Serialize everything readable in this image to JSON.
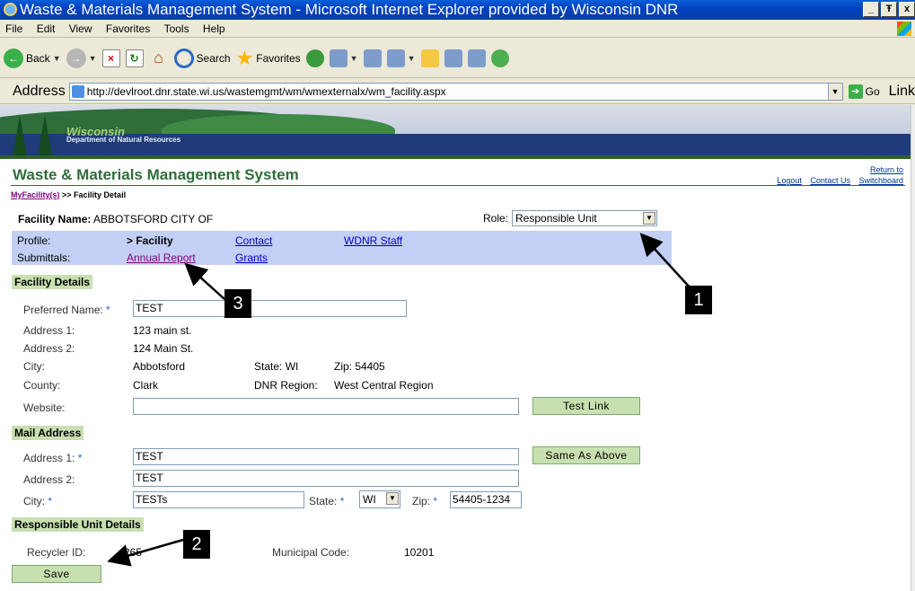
{
  "window": {
    "title": "Waste & Materials Management System - Microsoft Internet Explorer provided by Wisconsin DNR",
    "controls": [
      "_",
      "Ŧ",
      "x"
    ]
  },
  "menu": [
    "File",
    "Edit",
    "View",
    "Favorites",
    "Tools",
    "Help"
  ],
  "toolbar": {
    "back": "Back",
    "search": "Search",
    "favorites": "Favorites"
  },
  "address": {
    "label": "Address",
    "url": "http://devlroot.dnr.state.wi.us/wastemgmt/wm/wmexternalx/wm_facility.aspx",
    "go": "Go",
    "links": "Link"
  },
  "banner": {
    "org_title": "Wisconsin",
    "org_sub": "Department of Natural Resources"
  },
  "header": {
    "app_title": "Waste & Materials Management System",
    "logout": "Logout",
    "contact": "Contact Us",
    "return_top": "Return to",
    "return_bottom": "Switchboard"
  },
  "breadcrumb": {
    "link": "MyFacility(s)",
    "rest": ">> Facility Detail"
  },
  "facility": {
    "name_label": "Facility Name:",
    "name_value": "ABBOTSFORD CITY OF",
    "role_label": "Role:",
    "role_value": "Responsible Unit"
  },
  "nav": {
    "profile_label": "Profile:",
    "current": "> Facility",
    "contact": "Contact",
    "staff": "WDNR Staff",
    "submittals_label": "Submittals:",
    "annual": "Annual Report",
    "grants": "Grants"
  },
  "facility_details": {
    "header": "Facility Details",
    "preferred_label": "Preferred Name:",
    "preferred_value": "TEST",
    "addr1_label": "Address 1:",
    "addr1_value": "123 main st.",
    "addr2_label": "Address 2:",
    "addr2_value": "124 Main St.",
    "city_label": "City:",
    "city_value": "Abbotsford",
    "state_text": "State: WI",
    "zip_text": "Zip: 54405",
    "county_label": "County:",
    "county_value": "Clark",
    "region_label": "DNR Region:",
    "region_value": "West Central Region",
    "website_label": "Website:",
    "website_value": "",
    "test_link": "Test Link"
  },
  "mail_address": {
    "header": "Mail Address",
    "addr1_label": "Address 1:",
    "addr1_value": "TEST",
    "same_as_above": "Same As Above",
    "addr2_label": "Address 2:",
    "addr2_value": "TEST",
    "city_label": "City:",
    "city_value": "TESTs",
    "state_label": "State:",
    "state_value": "WI",
    "zip_label": "Zip:",
    "zip_value": "54405-1234"
  },
  "responsible_unit": {
    "header": "Responsible Unit Details",
    "recycler_label": "Recycler ID:",
    "recycler_value": "265",
    "municipal_label": "Municipal Code:",
    "municipal_value": "10201",
    "save": "Save"
  },
  "callouts": [
    "1",
    "2",
    "3"
  ],
  "required_mark": "*"
}
